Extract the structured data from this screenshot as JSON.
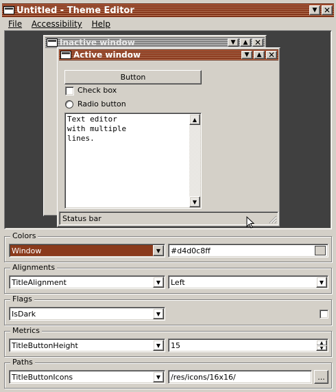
{
  "window": {
    "title": "Untitled - Theme Editor"
  },
  "menubar": {
    "file": "File",
    "accessibility": "Accessibility",
    "help": "Help"
  },
  "preview": {
    "inactive_title": "Inactive window",
    "active_title": "Active window",
    "button_label": "Button",
    "checkbox_label": "Check box",
    "radio_label": "Radio button",
    "text_editor": "Text editor\nwith multiple\nlines.",
    "status_bar": "Status bar"
  },
  "colors": {
    "legend": "Colors",
    "selected": "Window",
    "value": "#d4d0c8ff",
    "swatch": "#d4d0c8"
  },
  "alignments": {
    "legend": "Alignments",
    "selected": "TitleAlignment",
    "value": "Left"
  },
  "flags": {
    "legend": "Flags",
    "selected": "IsDark",
    "checked": false
  },
  "metrics": {
    "legend": "Metrics",
    "selected": "TitleButtonHeight",
    "value": "15"
  },
  "paths": {
    "legend": "Paths",
    "selected": "TitleButtonIcons",
    "value": "/res/icons/16x16/",
    "browse": "..."
  },
  "accent": "#8a3a1c"
}
